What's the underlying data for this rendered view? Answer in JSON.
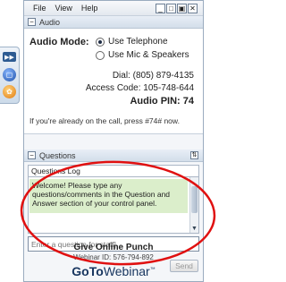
{
  "menu": {
    "items": [
      "File",
      "View",
      "Help"
    ]
  },
  "window_controls": [
    "_",
    "□",
    "▣",
    "✕"
  ],
  "audio": {
    "section_title": "Audio",
    "mode_label": "Audio Mode:",
    "options": [
      "Use Telephone",
      "Use Mic & Speakers"
    ],
    "selected": "Use Telephone",
    "dial": "Dial: (805) 879-4135",
    "access_code": "Access Code: 105-748-644",
    "audio_pin": "Audio PIN: 74",
    "note": "If you're already on the call, press #74# now."
  },
  "questions": {
    "section_title": "Questions",
    "log_label": "Questions Log",
    "welcome": "Welcome! Please type any questions/comments in the Question and Answer section of your control panel.",
    "input_placeholder": "Enter a question for staff]",
    "send_label": "Send"
  },
  "footer": {
    "org": "Give Online Punch",
    "webinar_id": "Webinar ID: 576-794-892",
    "brand_bold": "GoTo",
    "brand_rest": "Webinar",
    "brand_mark": "™"
  },
  "colors": {
    "accent": "#17355f",
    "annotation": "#e01010",
    "welcome_bg": "#dbeecb"
  }
}
